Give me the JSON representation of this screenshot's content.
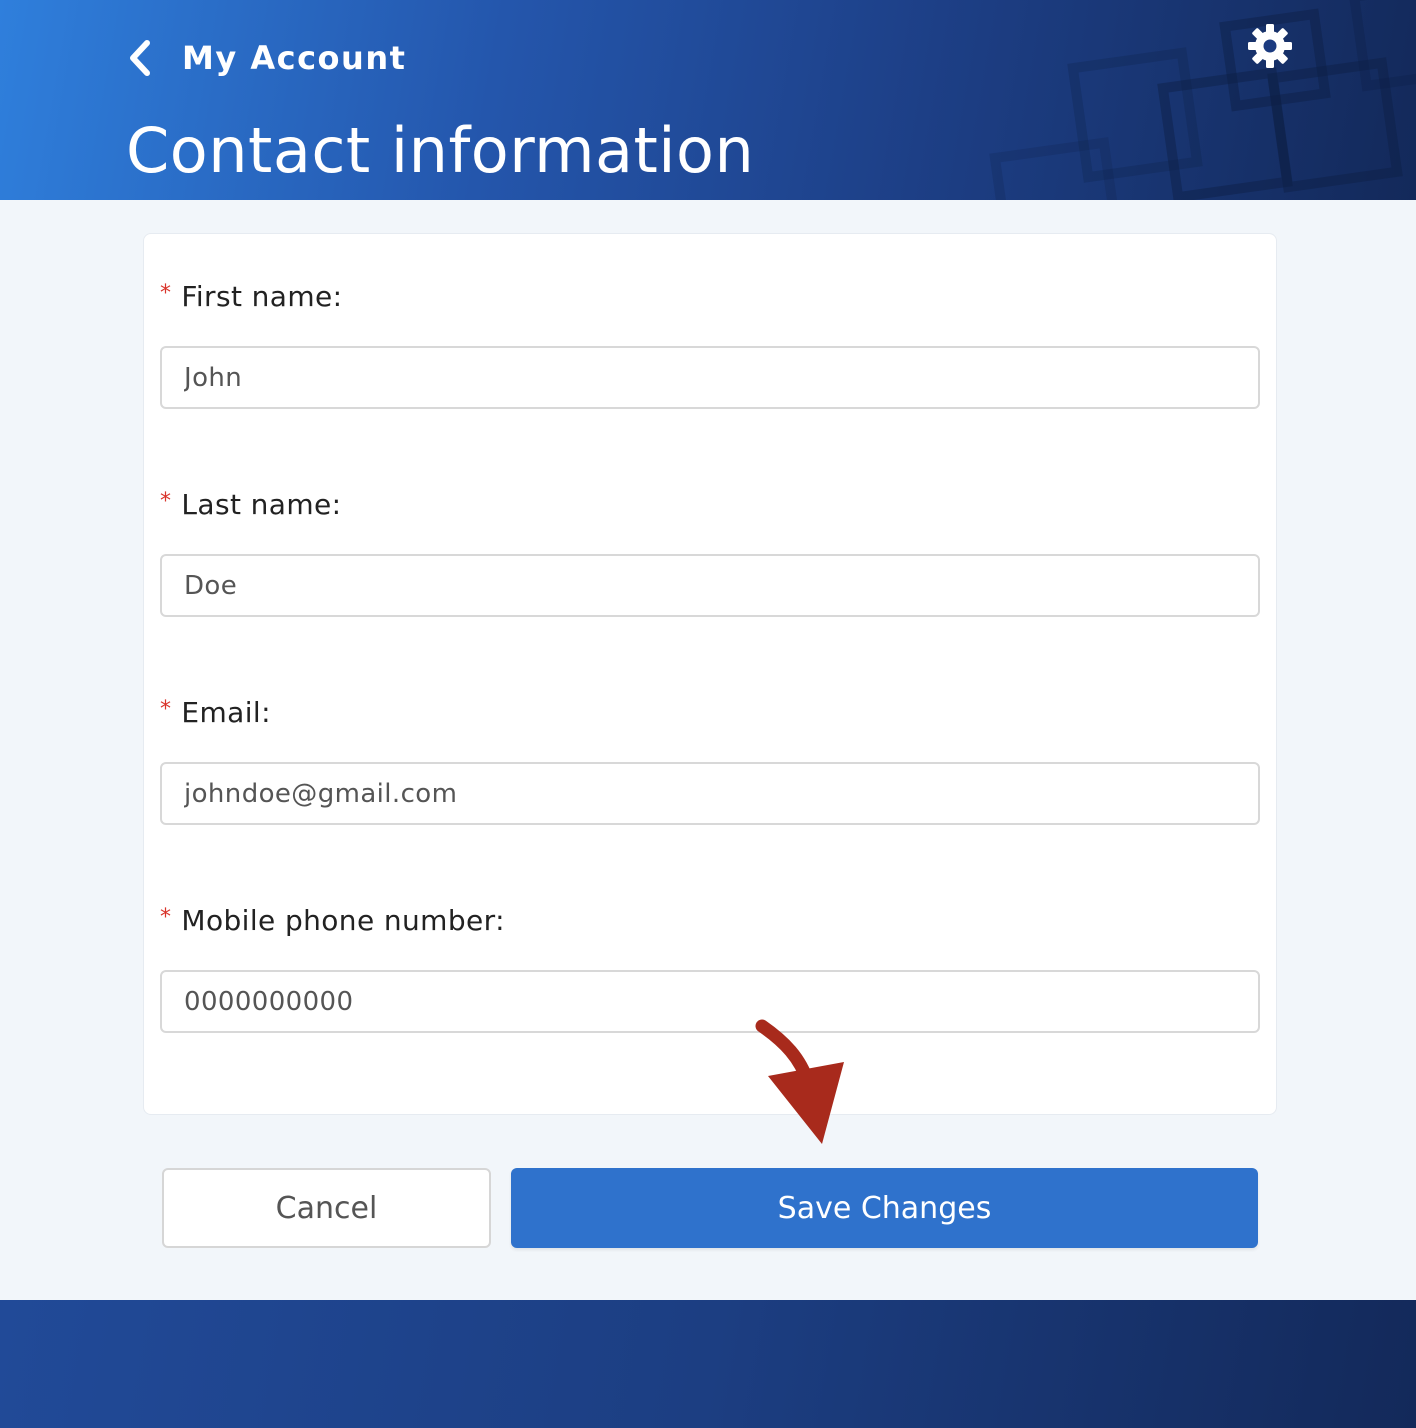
{
  "header": {
    "back_label": "My Account",
    "title": "Contact information"
  },
  "form": {
    "fields": [
      {
        "label": "First name",
        "required_mark": "*",
        "value": "John"
      },
      {
        "label": "Last name",
        "required_mark": "*",
        "value": "Doe"
      },
      {
        "label": "Email",
        "required_mark": "*",
        "value": "johndoe@gmail.com"
      },
      {
        "label": "Mobile phone number",
        "required_mark": "*",
        "value": "0000000000"
      }
    ],
    "label_suffix": ":"
  },
  "actions": {
    "cancel_label": "Cancel",
    "save_label": "Save Changes"
  },
  "icons": {
    "back": "chevron-left-icon",
    "settings": "gear-icon",
    "annotation": "curved-arrow-icon"
  },
  "colors": {
    "primary": "#2f72cc",
    "header_start": "#2f7fdc",
    "header_end": "#13295a",
    "required": "#d9342b",
    "annotation_arrow": "#a82a1c"
  }
}
